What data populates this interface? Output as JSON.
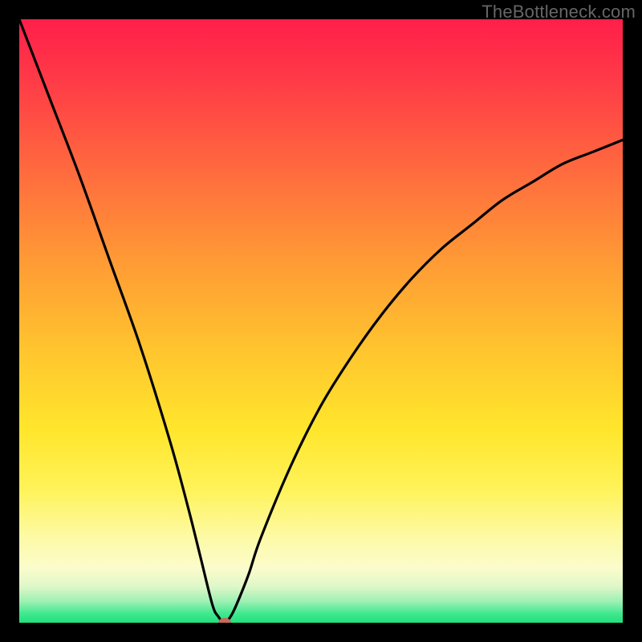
{
  "watermark": "TheBottleneck.com",
  "chart_data": {
    "type": "line",
    "title": "",
    "xlabel": "",
    "ylabel": "",
    "xlim": [
      0,
      100
    ],
    "ylim": [
      0,
      100
    ],
    "grid": false,
    "legend": false,
    "series": [
      {
        "name": "bottleneck-curve",
        "x": [
          0,
          5,
          10,
          15,
          20,
          25,
          28,
          30,
          32,
          33,
          34,
          35,
          36,
          38,
          40,
          45,
          50,
          55,
          60,
          65,
          70,
          75,
          80,
          85,
          90,
          95,
          100
        ],
        "y": [
          100,
          87,
          74,
          60,
          46,
          30,
          19,
          11,
          3,
          1,
          0,
          1,
          3,
          8,
          14,
          26,
          36,
          44,
          51,
          57,
          62,
          66,
          70,
          73,
          76,
          78,
          80
        ]
      }
    ],
    "minimum": {
      "x": 34,
      "y": 0
    },
    "colors": {
      "curve": "#000000",
      "dot": "#c76a5a",
      "gradient_top": "#ff1f4a",
      "gradient_bottom": "#23e07a"
    }
  }
}
